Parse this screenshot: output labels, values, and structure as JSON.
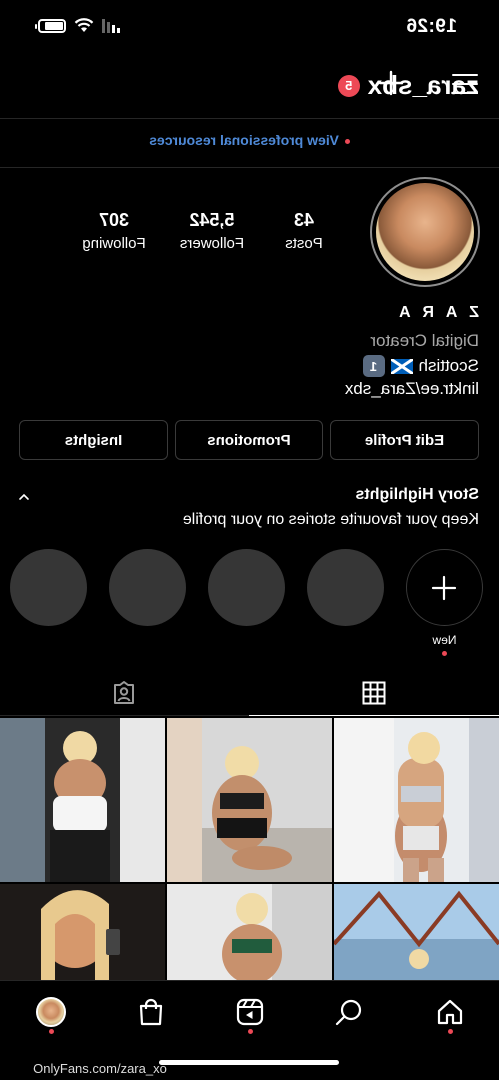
{
  "status_bar": {
    "time": "19:26"
  },
  "header": {
    "username": "zara_sbx",
    "notification_count": "5"
  },
  "professional": {
    "link_text": "View professional resources"
  },
  "stats": [
    {
      "value": "43",
      "label": "Posts"
    },
    {
      "value": "5,542",
      "label": "Followers"
    },
    {
      "value": "307",
      "label": "Following"
    }
  ],
  "bio": {
    "name": "Z A R A",
    "category": "Digital Creator",
    "line": "Scottish",
    "emoji_square": "1",
    "link": "linktr.ee/Zara_sbx"
  },
  "buttons": {
    "edit": "Edit Profile",
    "promotions": "Promotions",
    "insights": "Insights"
  },
  "highlights": {
    "title": "Story Highlights",
    "subtitle": "Keep your favourite stories on your profile",
    "new_label": "New"
  },
  "tabs": [
    {
      "icon": "grid-icon",
      "active": true
    },
    {
      "icon": "tagged-icon",
      "active": false
    }
  ],
  "nav": [
    "home-icon",
    "search-icon",
    "reels-icon",
    "shop-icon",
    "profile-avatar"
  ],
  "watermark": "OnlyFans.com/zara_xo",
  "colors": {
    "accent_blue": "#4f8ad8",
    "badge_red": "#ed4956",
    "divider": "#262626"
  }
}
